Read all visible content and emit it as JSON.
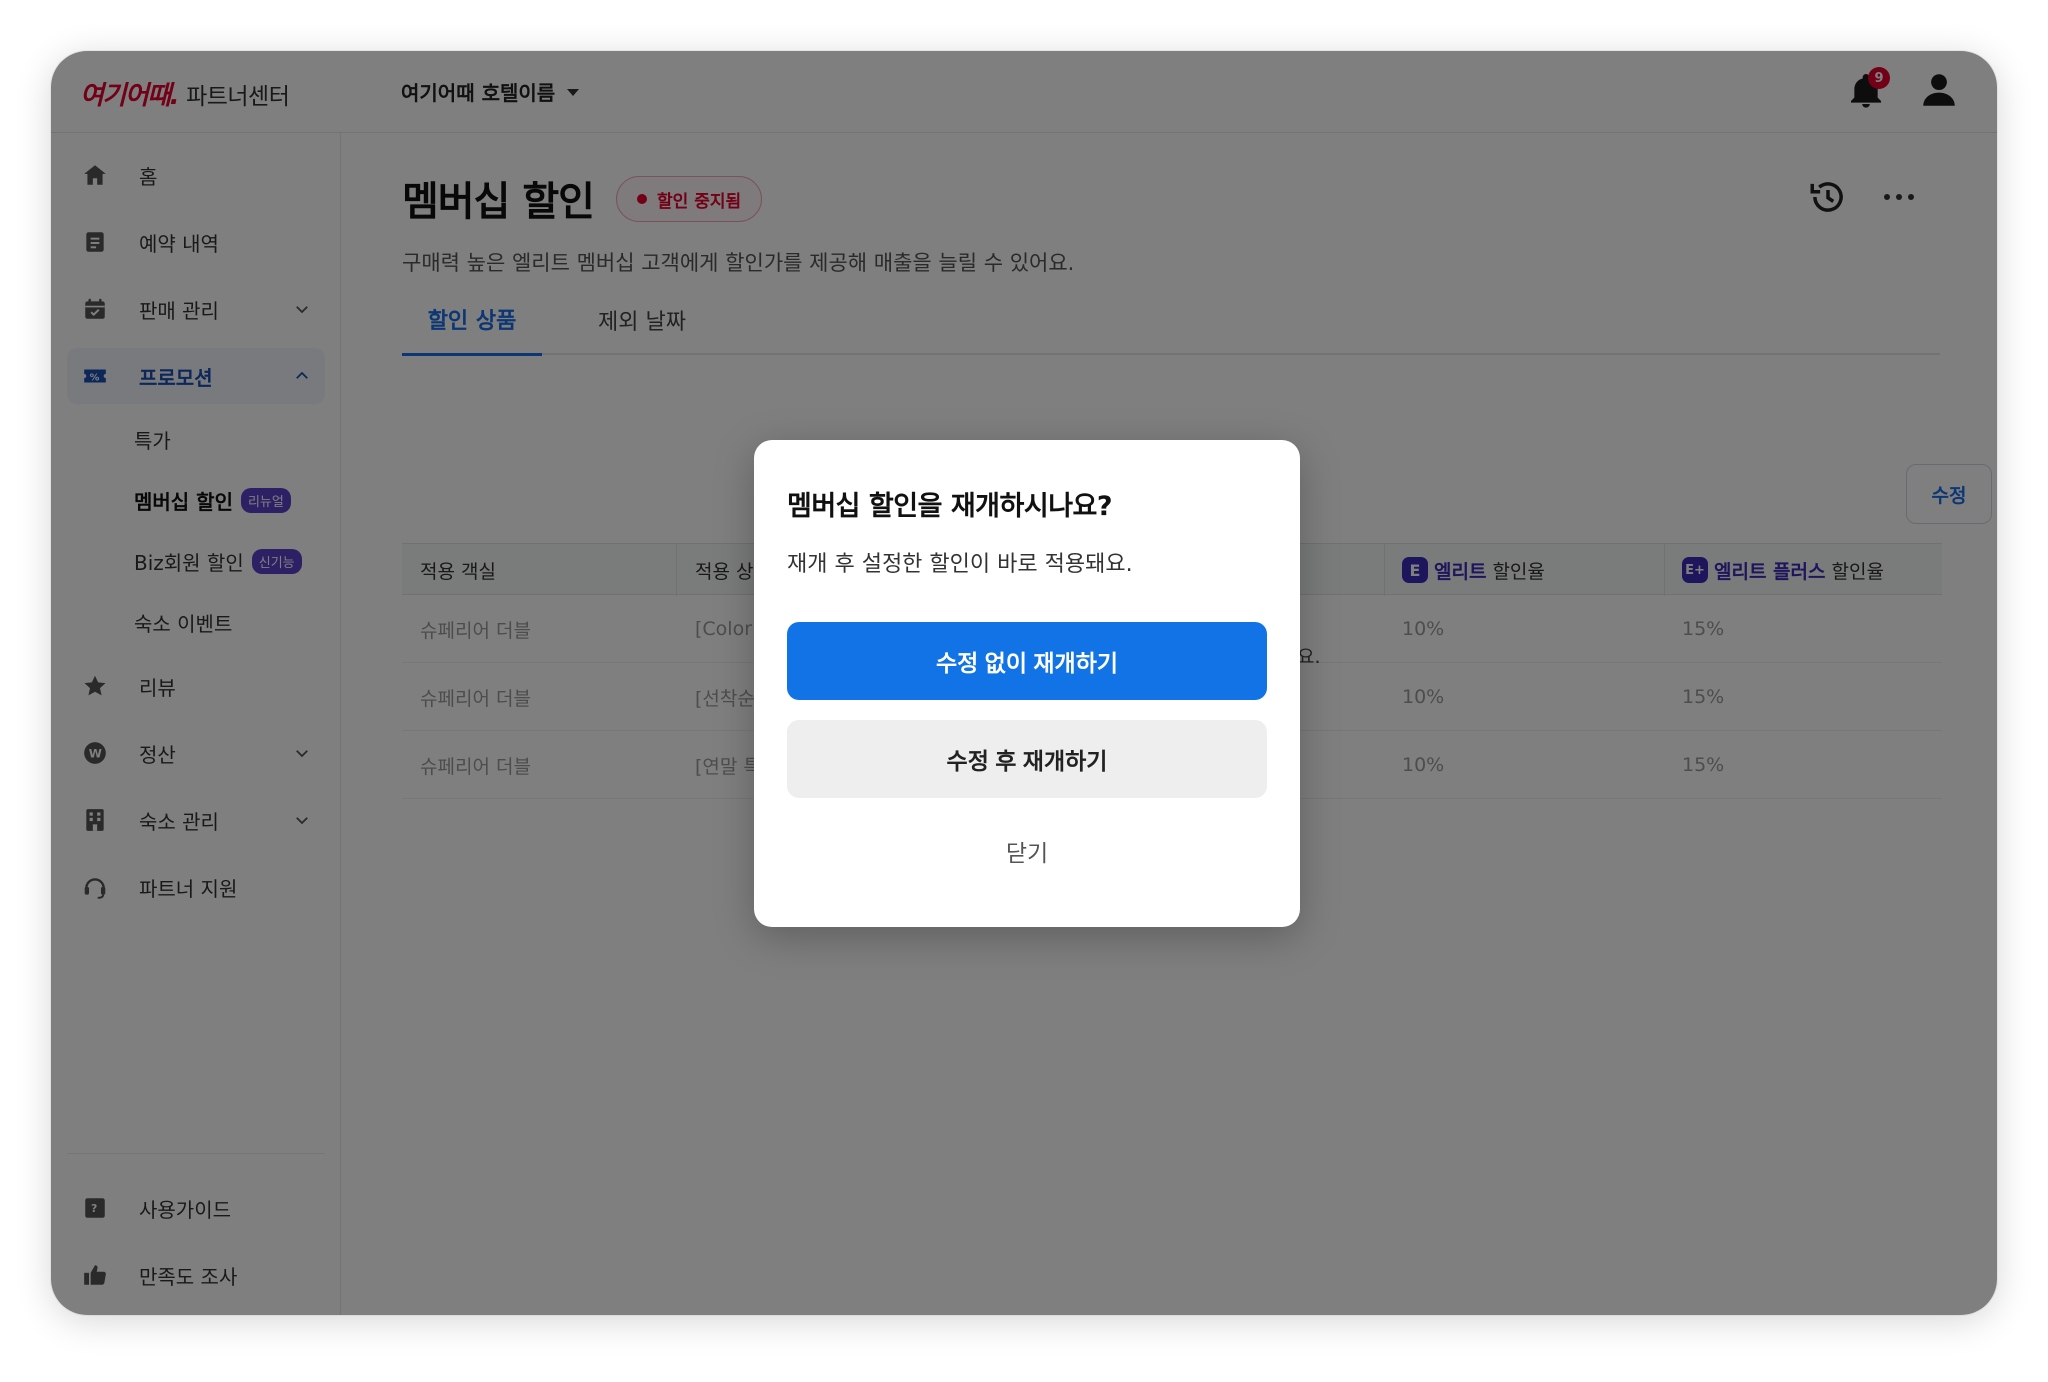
{
  "brand": {
    "logo": "여기어때.",
    "subtitle": "파트너센터"
  },
  "header": {
    "hotel_name": "여기어때 호텔이름",
    "notification_count": "9"
  },
  "sidebar": {
    "items": [
      {
        "label": "홈",
        "icon": "home-icon"
      },
      {
        "label": "예약 내역",
        "icon": "document-icon"
      },
      {
        "label": "판매 관리",
        "icon": "calendar-icon"
      },
      {
        "label": "프로모션",
        "icon": "coupon-icon"
      },
      {
        "label": "리뷰",
        "icon": "star-icon"
      },
      {
        "label": "정산",
        "icon": "won-icon"
      },
      {
        "label": "숙소 관리",
        "icon": "building-icon"
      },
      {
        "label": "파트너 지원",
        "icon": "headset-icon"
      }
    ],
    "promo_sub": [
      {
        "label": "특가"
      },
      {
        "label": "멤버십 할인",
        "badge": "리뉴얼"
      },
      {
        "label": "Biz회원 할인",
        "badge": "신기능"
      },
      {
        "label": "숙소 이벤트"
      }
    ],
    "bottom": [
      {
        "label": "사용가이드",
        "icon": "guide-icon"
      },
      {
        "label": "만족도 조사",
        "icon": "thumbs-up-icon"
      }
    ]
  },
  "page": {
    "title": "멤버십 할인",
    "status": "할인 중지됨",
    "description": "구매력 높은 엘리트 멤버십 고객에게 할인가를 제공해 매출을 늘릴 수 있어요.",
    "tabs": [
      {
        "label": "할인 상품"
      },
      {
        "label": "제외 날짜"
      }
    ],
    "edit_label": "수정"
  },
  "table": {
    "headers": {
      "room": "적용 객실",
      "product": "적용 상",
      "elite_icon": "E",
      "elite_name": "엘리트",
      "elite_rate": "할인율",
      "elite_plus_icon": "E+",
      "elite_plus_name": "엘리트 플러스",
      "elite_plus_rate": "할인율"
    },
    "rows": [
      {
        "room": "슈페리어 더블",
        "product": "[Color",
        "elite": "10%",
        "elite_plus": "15%"
      },
      {
        "room": "슈페리어 더블",
        "product": "[선착순",
        "elite": "10%",
        "elite_plus": "15%"
      },
      {
        "room": "슈페리어 더블",
        "product": "[연말 특",
        "elite": "10%",
        "elite_plus": "15%"
      }
    ],
    "note_fragment": "요."
  },
  "modal": {
    "title": "멤버십 할인을 재개하시나요?",
    "body": "재개 후 설정한 할인이 바로 적용돼요.",
    "primary": "수정 없이 재개하기",
    "secondary": "수정 후 재개하기",
    "close": "닫기"
  },
  "colors": {
    "brand": "#e5002d",
    "accent": "#1273e6",
    "elite": "#3b2dbb",
    "overlay": "rgba(0,0,0,0.5)"
  }
}
